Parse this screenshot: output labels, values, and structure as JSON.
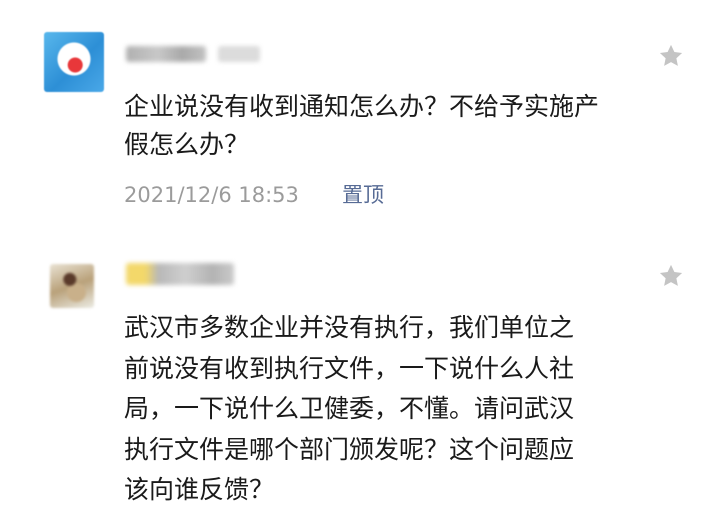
{
  "comments": [
    {
      "text": "企业说没有收到通知怎么办？不给予实施产假怎么办？",
      "timestamp": "2021/12/6 18:53",
      "pin_label": "置顶",
      "star_icon": "☆"
    },
    {
      "text": "武汉市多数企业并没有执行，我们单位之前说没有收到执行文件，一下说什么人社局，一下说什么卫健委，不懂。请问武汉执行文件是哪个部门颁发呢？这个问题应该向谁反馈？",
      "star_icon": "☆"
    }
  ],
  "colors": {
    "text": "#1a1a1a",
    "timestamp": "#9b9b9b",
    "link": "#576b95",
    "star": "#c4c4c4"
  }
}
